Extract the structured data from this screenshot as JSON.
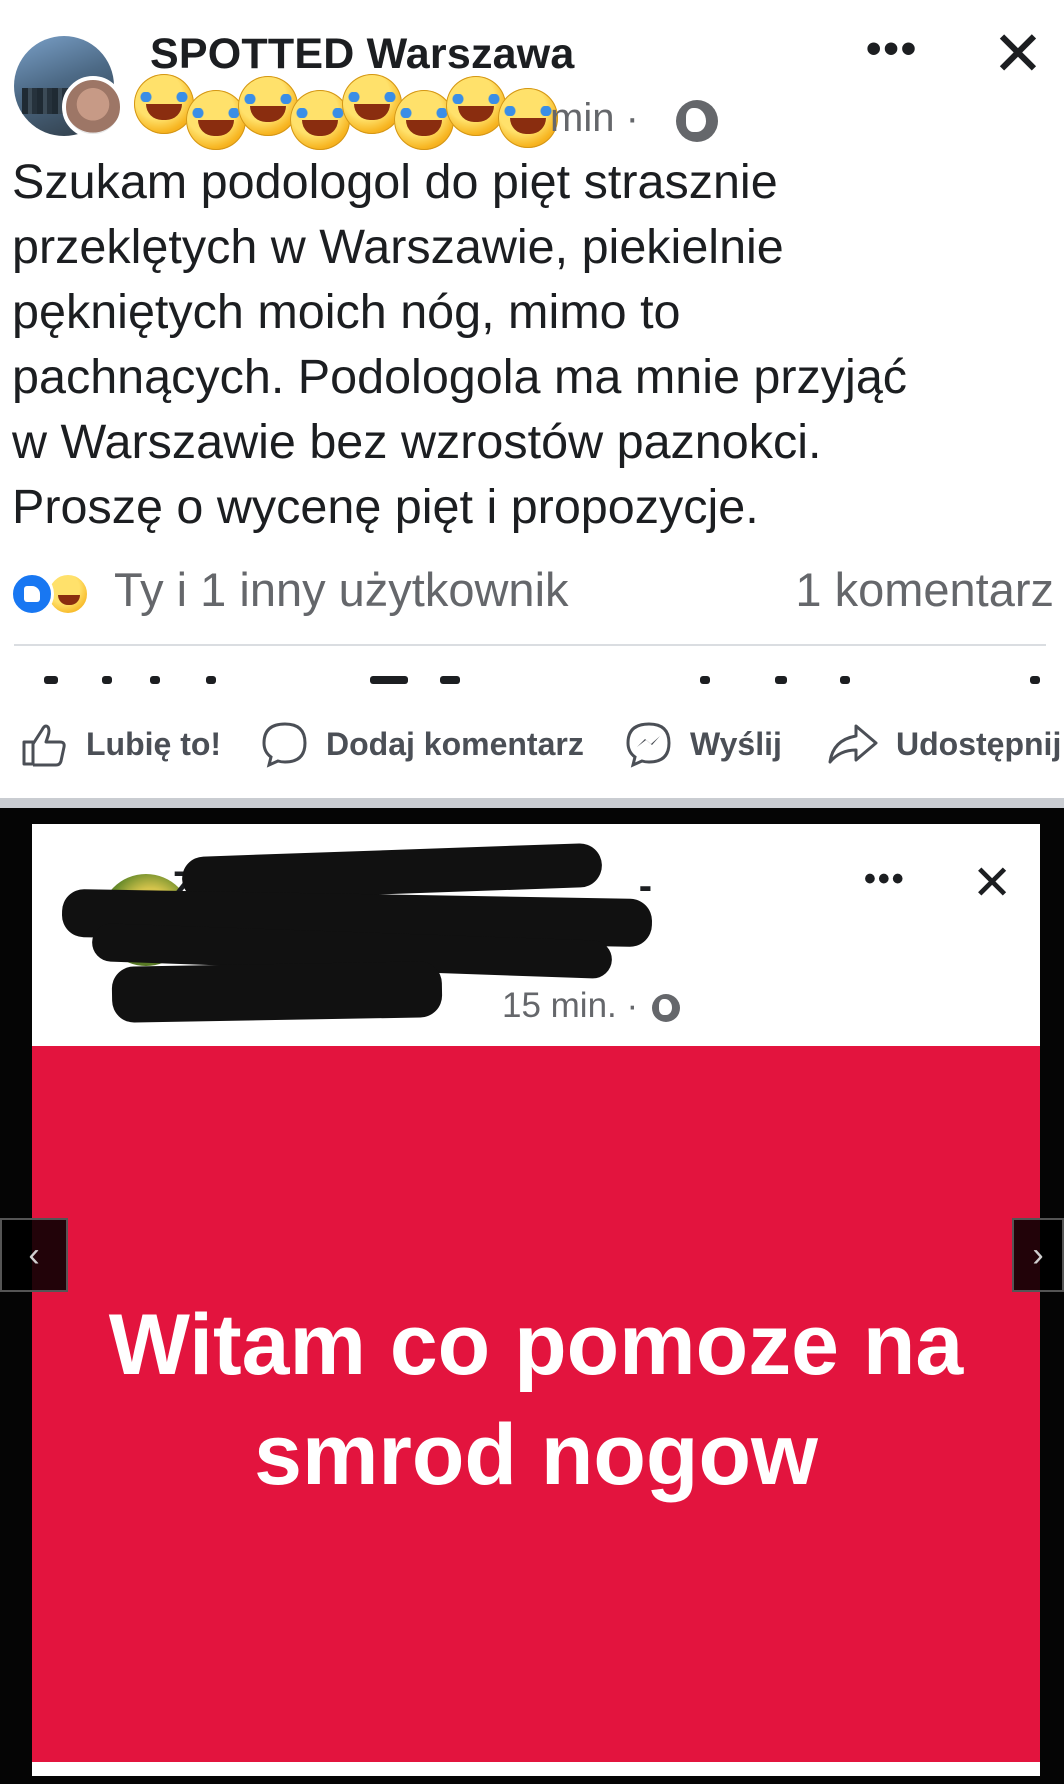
{
  "post": {
    "page_name": "SPOTTED Warszawa",
    "time": "min ·",
    "body_lines": [
      "Szukam podologol do pięt strasznie",
      "przeklętych w Warszawie, piekielnie",
      "pękniętych moich nóg, mimo to",
      "pachnących. Podologola ma mnie przyjąć",
      "w Warszawie bez wzrostów paznokci.",
      "Proszę o wycenę pięt i propozycje."
    ],
    "reactions_text": "Ty i 1 inny użytkownik",
    "comments_count": "1 komentarz",
    "more_icon": "•••",
    "close_icon": "✕",
    "reaction_icons": [
      "like-icon",
      "haha-icon"
    ],
    "actions": {
      "like": "Lubię to!",
      "comment": "Dodaj komentarz",
      "send": "Wyślij",
      "share": "Udostępnij"
    }
  },
  "shared": {
    "name_visible": "Z",
    "name_tail": "-",
    "time": "15 min. ·",
    "more_icon": "•••",
    "close_icon": "✕",
    "image_text_line1": "Witam co pomoze na",
    "image_text_line2": "smrod nogow",
    "prev_arrow": "‹",
    "next_arrow": "›"
  },
  "colors": {
    "accent": "#1877f2",
    "image_background": "#e3143e",
    "secondary_text": "#65676b"
  }
}
